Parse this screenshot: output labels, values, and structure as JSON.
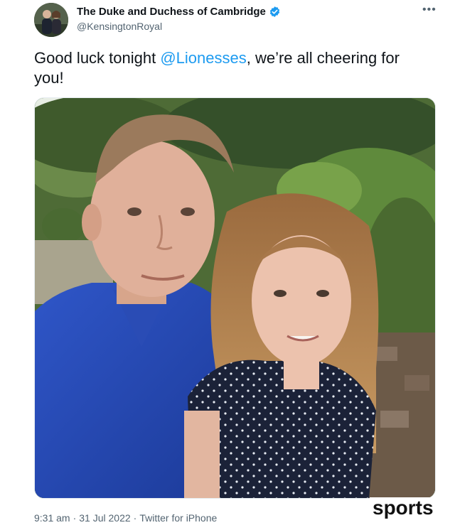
{
  "author": {
    "display_name": "The Duke and Duchess of Cambridge",
    "handle": "@KensingtonRoyal",
    "verified": true,
    "avatar_icon": "profile-photo"
  },
  "tweet": {
    "text_before": "Good luck tonight ",
    "mention": "@Lionesses",
    "text_after": ", we’re all cheering for you!"
  },
  "media": {
    "type": "video-still",
    "description_icon": "photo"
  },
  "meta": {
    "time": "9:31 am",
    "date": "31 Jul 2022",
    "source": "Twitter for iPhone",
    "separator": "·"
  },
  "more_icon": "ellipsis-icon",
  "watermark": "sports",
  "colors": {
    "mention": "#1d9bf0",
    "verified": "#1d9bf0",
    "secondary_text": "#536471",
    "primary_text": "#0f1419"
  }
}
